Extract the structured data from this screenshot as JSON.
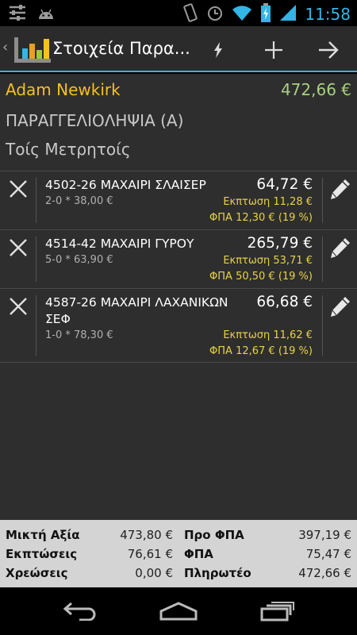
{
  "status_bar": {
    "time": "11:58",
    "icons_left": [
      "settings-sliders-icon",
      "android-icon"
    ],
    "icons_right": [
      "vibrate-icon",
      "alarm-icon",
      "wifi-icon",
      "battery-charging-icon",
      "signal-icon"
    ]
  },
  "action_bar": {
    "title": "Στοιχεία Παρα...",
    "actions": [
      "flash-icon",
      "add-icon",
      "arrow-forward-icon"
    ]
  },
  "customer": {
    "name": "Adam Newkirk",
    "total": "472,66 €",
    "document_type": "ΠΑΡΑΓΓΕΛΙΟΛΗΨΙΑ (Α)",
    "payment_method": "Τοίς Μετρητοίς"
  },
  "items": [
    {
      "name": "4502-26 ΜΑΧΑΙΡΙ ΣΛΑΙΣΕΡ",
      "price": "64,72 €",
      "qty": "2-0 * 38,00 €",
      "discount_label": "Εκπτωση",
      "discount": "11,28 €",
      "vat_label": "ΦΠΑ",
      "vat": "12,30 € (19 %)"
    },
    {
      "name": "4514-42 ΜΑΧΑΙΡΙ ΓΥΡΟΥ",
      "price": "265,79 €",
      "qty": "5-0 * 63,90 €",
      "discount_label": "Εκπτωση",
      "discount": "53,71 €",
      "vat_label": "ΦΠΑ",
      "vat": "50,50 € (19 %)"
    },
    {
      "name": "4587-26 ΜΑΧΑΙΡΙ ΛΑΧΑΝΙΚΩΝ ΣΕΦ",
      "price": "66,68 €",
      "qty": "1-0 * 78,30 €",
      "discount_label": "Εκπτωση",
      "discount": "11,62 €",
      "vat_label": "ΦΠΑ",
      "vat": "12,67 € (19 %)"
    }
  ],
  "summary": {
    "gross_label": "Μικτή Αξία",
    "gross": "473,80 €",
    "pre_vat_label": "Προ ΦΠΑ",
    "pre_vat": "397,19 €",
    "discounts_label": "Εκπτώσεις",
    "discounts": "76,61 €",
    "vat_label": "ΦΠΑ",
    "vat": "75,47 €",
    "charges_label": "Χρεώσεις",
    "charges": "0,00 €",
    "payable_label": "Πληρωτέο",
    "payable": "472,66 €"
  },
  "nav_bar": [
    "back-icon",
    "home-icon",
    "recent-apps-icon"
  ],
  "colors": {
    "accent": "#33b5e5",
    "customer_name": "#f5c21b",
    "customer_total": "#a8d080",
    "discount_vat": "#e8d24a"
  }
}
